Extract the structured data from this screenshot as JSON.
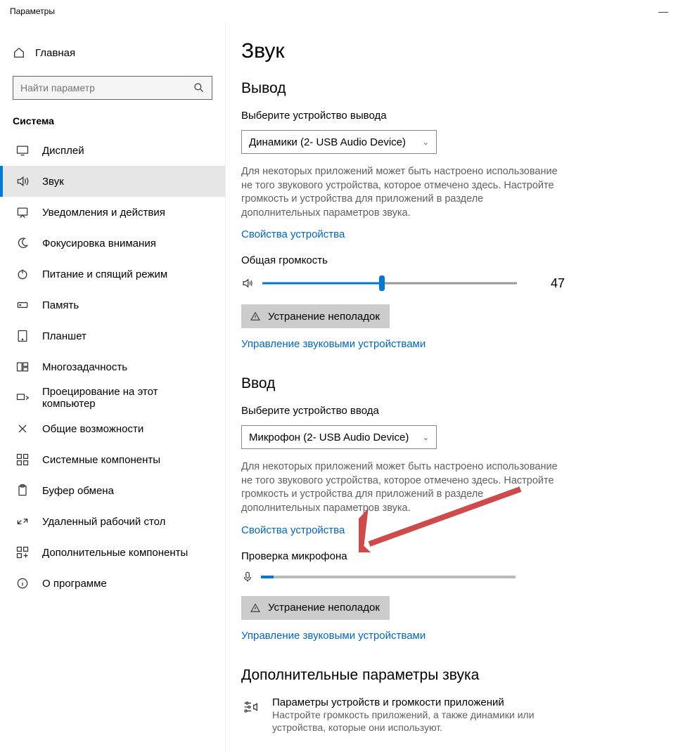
{
  "window": {
    "title": "Параметры"
  },
  "sidebar": {
    "home": "Главная",
    "search_placeholder": "Найти параметр",
    "section": "Система",
    "items": [
      {
        "id": "display",
        "label": "Дисплей"
      },
      {
        "id": "sound",
        "label": "Звук",
        "active": true
      },
      {
        "id": "notifications",
        "label": "Уведомления и действия"
      },
      {
        "id": "focus",
        "label": "Фокусировка внимания"
      },
      {
        "id": "power",
        "label": "Питание и спящий режим"
      },
      {
        "id": "storage",
        "label": "Память"
      },
      {
        "id": "tablet",
        "label": "Планшет"
      },
      {
        "id": "multitask",
        "label": "Многозадачность"
      },
      {
        "id": "projecting",
        "label": "Проецирование на этот компьютер"
      },
      {
        "id": "shared",
        "label": "Общие возможности"
      },
      {
        "id": "components",
        "label": "Системные компоненты"
      },
      {
        "id": "clipboard",
        "label": "Буфер обмена"
      },
      {
        "id": "remote",
        "label": "Удаленный рабочий стол"
      },
      {
        "id": "optional",
        "label": "Дополнительные компоненты"
      },
      {
        "id": "about",
        "label": "О программе"
      }
    ]
  },
  "content": {
    "page_title": "Звук",
    "output": {
      "heading": "Вывод",
      "select_label": "Выберите устройство вывода",
      "device": "Динамики (2- USB Audio Device)",
      "hint": "Для некоторых приложений может быть настроено использование не того звукового устройства, которое отмечено здесь. Настройте громкость и устройства для приложений в разделе дополнительных параметров звука.",
      "props_link": "Свойства устройства",
      "volume_label": "Общая громкость",
      "volume_value": 47,
      "troubleshoot": "Устранение неполадок",
      "manage_link": "Управление звуковыми устройствами"
    },
    "input": {
      "heading": "Ввод",
      "select_label": "Выберите устройство ввода",
      "device": "Микрофон (2- USB Audio Device)",
      "hint": "Для некоторых приложений может быть настроено использование не того звукового устройства, которое отмечено здесь. Настройте громкость и устройства для приложений в разделе дополнительных параметров звука.",
      "props_link": "Свойства устройства",
      "test_label": "Проверка микрофона",
      "test_level": 5,
      "troubleshoot": "Устранение неполадок",
      "manage_link": "Управление звуковыми устройствами"
    },
    "advanced": {
      "heading": "Дополнительные параметры звука",
      "appvol_title": "Параметры устройств и громкости приложений",
      "appvol_sub": "Настройте громкость приложений, а также динамики или устройства, которые они используют."
    }
  }
}
